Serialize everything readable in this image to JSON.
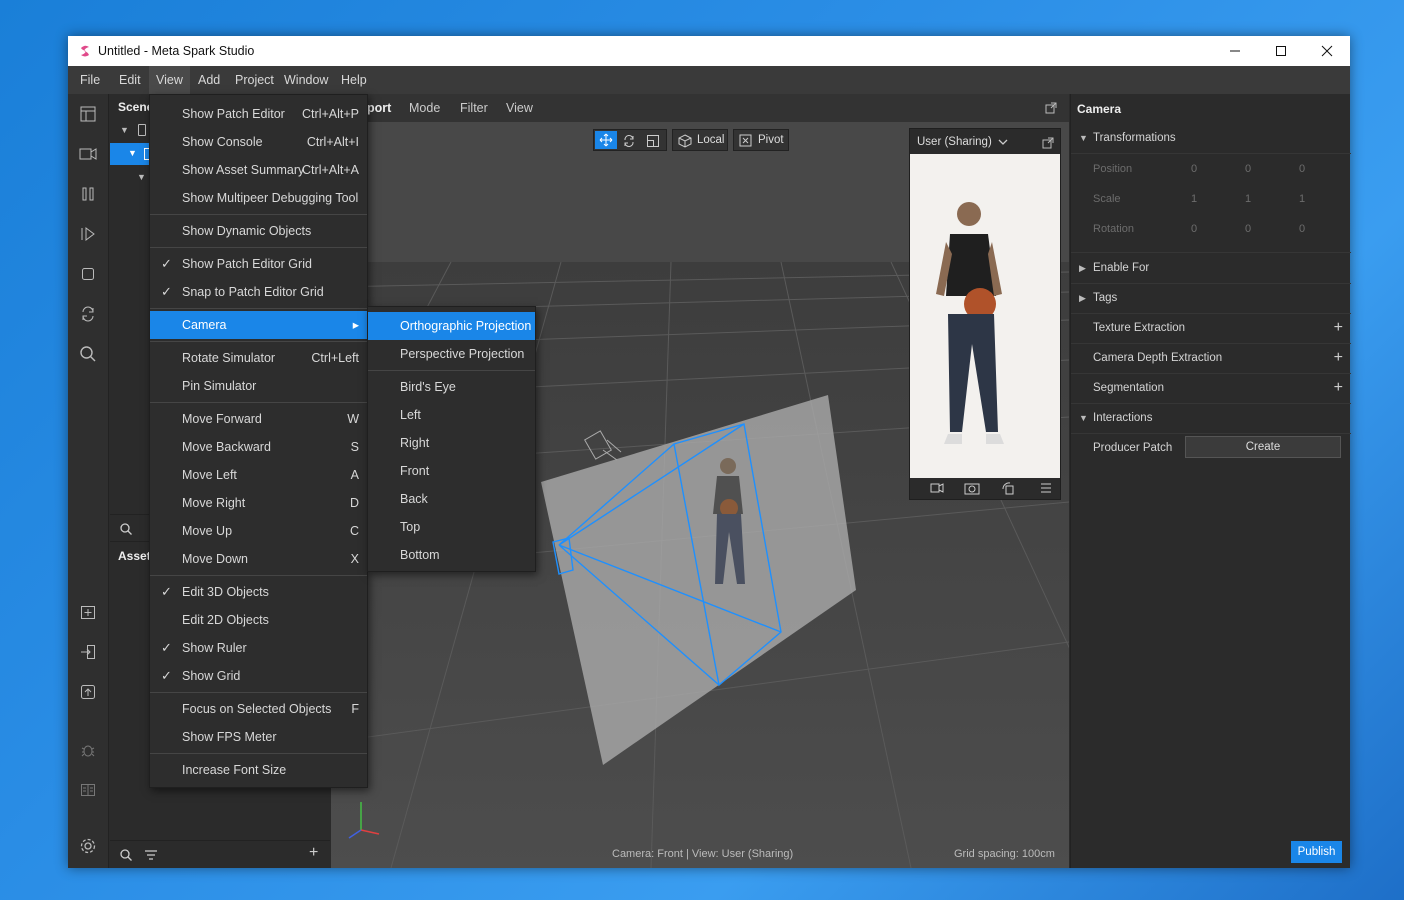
{
  "window": {
    "title": "Untitled - Meta Spark Studio",
    "minimize": "—",
    "maximize": "☐",
    "close": "✕"
  },
  "menubar": [
    "File",
    "Edit",
    "View",
    "Add",
    "Project",
    "Window",
    "Help"
  ],
  "scene": {
    "header": "Scene",
    "assets_header": "Assets"
  },
  "viewport": {
    "toolbar_partial": "port",
    "toolbar": [
      "Mode",
      "Filter",
      "View"
    ],
    "local_label": "Local",
    "pivot_label": "Pivot",
    "sim_device": "User (Sharing)",
    "status_left": "Camera: Front | View: User (Sharing)",
    "status_right": "Grid spacing: 100cm"
  },
  "view_menu": {
    "items": [
      {
        "label": "Show Patch Editor",
        "shortcut": "Ctrl+Alt+P",
        "checked": false
      },
      {
        "label": "Show Console",
        "shortcut": "Ctrl+Alt+I",
        "checked": false
      },
      {
        "label": "Show Asset Summary",
        "shortcut": "Ctrl+Alt+A",
        "checked": false
      },
      {
        "label": "Show Multipeer Debugging Tool",
        "shortcut": "",
        "checked": false
      },
      {
        "label": "Show Dynamic Objects",
        "shortcut": "",
        "checked": false
      },
      {
        "label": "Show Patch Editor Grid",
        "shortcut": "",
        "checked": true
      },
      {
        "label": "Snap to Patch Editor Grid",
        "shortcut": "",
        "checked": true
      },
      {
        "label": "Camera",
        "shortcut": "▸",
        "checked": false,
        "selected": true
      },
      {
        "label": "Rotate Simulator",
        "shortcut": "Ctrl+Left",
        "checked": false
      },
      {
        "label": "Pin Simulator",
        "shortcut": "",
        "checked": false
      },
      {
        "label": "Move Forward",
        "shortcut": "W",
        "checked": false
      },
      {
        "label": "Move Backward",
        "shortcut": "S",
        "checked": false
      },
      {
        "label": "Move Left",
        "shortcut": "A",
        "checked": false
      },
      {
        "label": "Move Right",
        "shortcut": "D",
        "checked": false
      },
      {
        "label": "Move Up",
        "shortcut": "C",
        "checked": false
      },
      {
        "label": "Move Down",
        "shortcut": "X",
        "checked": false
      },
      {
        "label": "Edit 3D Objects",
        "shortcut": "",
        "checked": true
      },
      {
        "label": "Edit 2D Objects",
        "shortcut": "",
        "checked": false
      },
      {
        "label": "Show Ruler",
        "shortcut": "",
        "checked": true
      },
      {
        "label": "Show Grid",
        "shortcut": "",
        "checked": true
      },
      {
        "label": "Focus on Selected Objects",
        "shortcut": "F",
        "checked": false
      },
      {
        "label": "Show FPS Meter",
        "shortcut": "",
        "checked": false
      },
      {
        "label": "Increase Font Size",
        "shortcut": "",
        "checked": false
      }
    ],
    "check_glyph": "✓"
  },
  "camera_submenu": [
    "Orthographic Projection",
    "Perspective Projection",
    "Bird's Eye",
    "Left",
    "Right",
    "Front",
    "Back",
    "Top",
    "Bottom"
  ],
  "inspector": {
    "title": "Camera",
    "transformations": "Transformations",
    "position": "Position",
    "scale": "Scale",
    "rotation": "Rotation",
    "position_vals": [
      "0",
      "0",
      "0"
    ],
    "scale_vals": [
      "1",
      "1",
      "1"
    ],
    "rotation_vals": [
      "0",
      "0",
      "0"
    ],
    "enable_for": "Enable For",
    "tags": "Tags",
    "texture_extraction": "Texture Extraction",
    "camera_depth": "Camera Depth Extraction",
    "segmentation": "Segmentation",
    "interactions": "Interactions",
    "producer_patch": "Producer Patch",
    "create": "Create",
    "publish": "Publish"
  },
  "colors": {
    "accent": "#1a86e8",
    "wireframe": "#1e90ff"
  }
}
